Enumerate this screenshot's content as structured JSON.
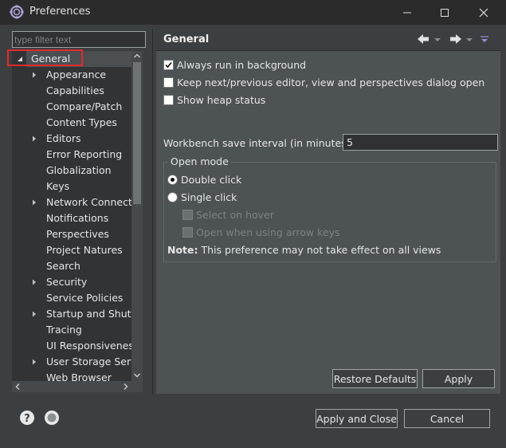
{
  "window": {
    "title": "Preferences",
    "controls": {
      "minimize": "minimize-icon",
      "maximize": "maximize-icon",
      "close": "close-icon"
    }
  },
  "filter": {
    "placeholder": "type filter text",
    "value": ""
  },
  "tree": {
    "items": [
      {
        "label": "General",
        "expanded": true,
        "selected": true,
        "level": 0
      },
      {
        "label": "Appearance",
        "hasChildren": true,
        "level": 1
      },
      {
        "label": "Capabilities",
        "hasChildren": false,
        "level": 1
      },
      {
        "label": "Compare/Patch",
        "hasChildren": false,
        "level": 1
      },
      {
        "label": "Content Types",
        "hasChildren": false,
        "level": 1
      },
      {
        "label": "Editors",
        "hasChildren": true,
        "level": 1
      },
      {
        "label": "Error Reporting",
        "hasChildren": false,
        "level": 1
      },
      {
        "label": "Globalization",
        "hasChildren": false,
        "level": 1
      },
      {
        "label": "Keys",
        "hasChildren": false,
        "level": 1
      },
      {
        "label": "Network Connecti",
        "hasChildren": true,
        "level": 1
      },
      {
        "label": "Notifications",
        "hasChildren": false,
        "level": 1
      },
      {
        "label": "Perspectives",
        "hasChildren": false,
        "level": 1
      },
      {
        "label": "Project Natures",
        "hasChildren": false,
        "level": 1
      },
      {
        "label": "Search",
        "hasChildren": false,
        "level": 1
      },
      {
        "label": "Security",
        "hasChildren": true,
        "level": 1
      },
      {
        "label": "Service Policies",
        "hasChildren": false,
        "level": 1
      },
      {
        "label": "Startup and Shutd",
        "hasChildren": true,
        "level": 1
      },
      {
        "label": "Tracing",
        "hasChildren": false,
        "level": 1
      },
      {
        "label": "UI Responsiveness",
        "hasChildren": false,
        "level": 1
      },
      {
        "label": "User Storage Serv",
        "hasChildren": true,
        "level": 1
      },
      {
        "label": "Web Browser",
        "hasChildren": false,
        "level": 1
      }
    ]
  },
  "page": {
    "title": "General",
    "nav": {
      "back": "back-arrow-icon",
      "forward": "forward-arrow-icon",
      "menu": "view-menu-icon"
    },
    "checkboxes": [
      {
        "label": "Always run in background",
        "checked": true
      },
      {
        "label": "Keep next/previous editor, view and perspectives dialog open",
        "checked": false
      },
      {
        "label": "Show heap status",
        "checked": false
      }
    ],
    "interval": {
      "label": "Workbench save interval (in minutes):",
      "value": "5"
    },
    "open_mode": {
      "legend": "Open mode",
      "double_click": "Double click",
      "single_click": "Single click",
      "selected": "double_click",
      "select_on_hover": "Select on hover",
      "open_arrow_keys": "Open when using arrow keys"
    },
    "note": {
      "bold": "Note:",
      "text": "This preference may not take effect on all views"
    },
    "restore_defaults": "Restore Defaults",
    "apply": "Apply"
  },
  "footer": {
    "apply_and_close": "Apply and Close",
    "cancel": "Cancel",
    "help_icon": "help-icon",
    "import_export_icon": "import-export-icon"
  },
  "colors": {
    "background": "#3c3f41",
    "content": "#4d5255",
    "tree_background": "#313335",
    "selection_highlight": "#e0292b"
  }
}
